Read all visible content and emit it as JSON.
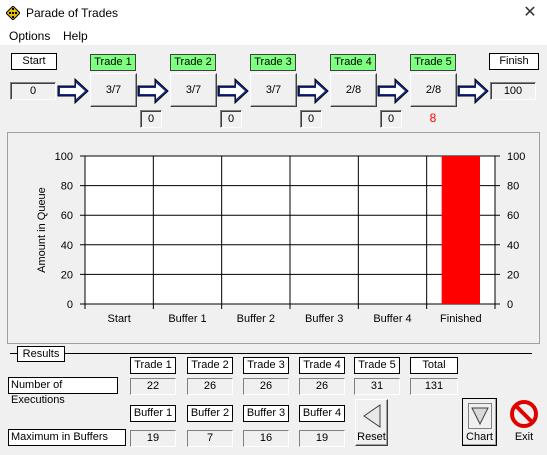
{
  "window": {
    "title": "Parade of Trades"
  },
  "menu": {
    "options": "Options",
    "help": "Help"
  },
  "pipeline": {
    "start": {
      "label": "Start",
      "value": "0"
    },
    "finish": {
      "label": "Finish",
      "value": "100"
    },
    "trades": [
      {
        "label": "Trade 1",
        "ratio": "3/7"
      },
      {
        "label": "Trade 2",
        "ratio": "3/7"
      },
      {
        "label": "Trade 3",
        "ratio": "3/7"
      },
      {
        "label": "Trade 4",
        "ratio": "2/8"
      },
      {
        "label": "Trade 5",
        "ratio": "2/8"
      }
    ],
    "buffers": [
      "0",
      "0",
      "0",
      "0"
    ],
    "trade5_extra": "8"
  },
  "chart_data": {
    "type": "bar",
    "categories": [
      "Start",
      "Buffer 1",
      "Buffer 2",
      "Buffer 3",
      "Buffer 4",
      "Finished"
    ],
    "values": [
      0,
      0,
      0,
      0,
      0,
      100
    ],
    "ylabel": "Amount in Queue",
    "yticks": [
      "0",
      "20",
      "40",
      "60",
      "80",
      "100"
    ],
    "ylim": [
      0,
      100
    ],
    "bar_color": "#ff0000",
    "grid": true
  },
  "results": {
    "title": "Results",
    "executions_label": "Number of Executions",
    "buffers_label": "Maximum in Buffers",
    "trade_headers": [
      "Trade 1",
      "Trade 2",
      "Trade 3",
      "Trade 4",
      "Trade 5",
      "Total"
    ],
    "executions": [
      "22",
      "26",
      "26",
      "26",
      "31",
      "131"
    ],
    "buffer_headers": [
      "Buffer 1",
      "Buffer 2",
      "Buffer 3",
      "Buffer 4"
    ],
    "max_buffers": [
      "19",
      "7",
      "16",
      "19"
    ]
  },
  "buttons": {
    "reset": "Reset",
    "chart": "Chart",
    "exit": "Exit"
  },
  "icons": {
    "app": "diamond-grid-icon",
    "close": "close-icon",
    "arrow": "right-arrow-icon",
    "reset": "reset-triangle-icon",
    "chart": "chart-funnel-icon",
    "exit": "no-entry-icon"
  }
}
